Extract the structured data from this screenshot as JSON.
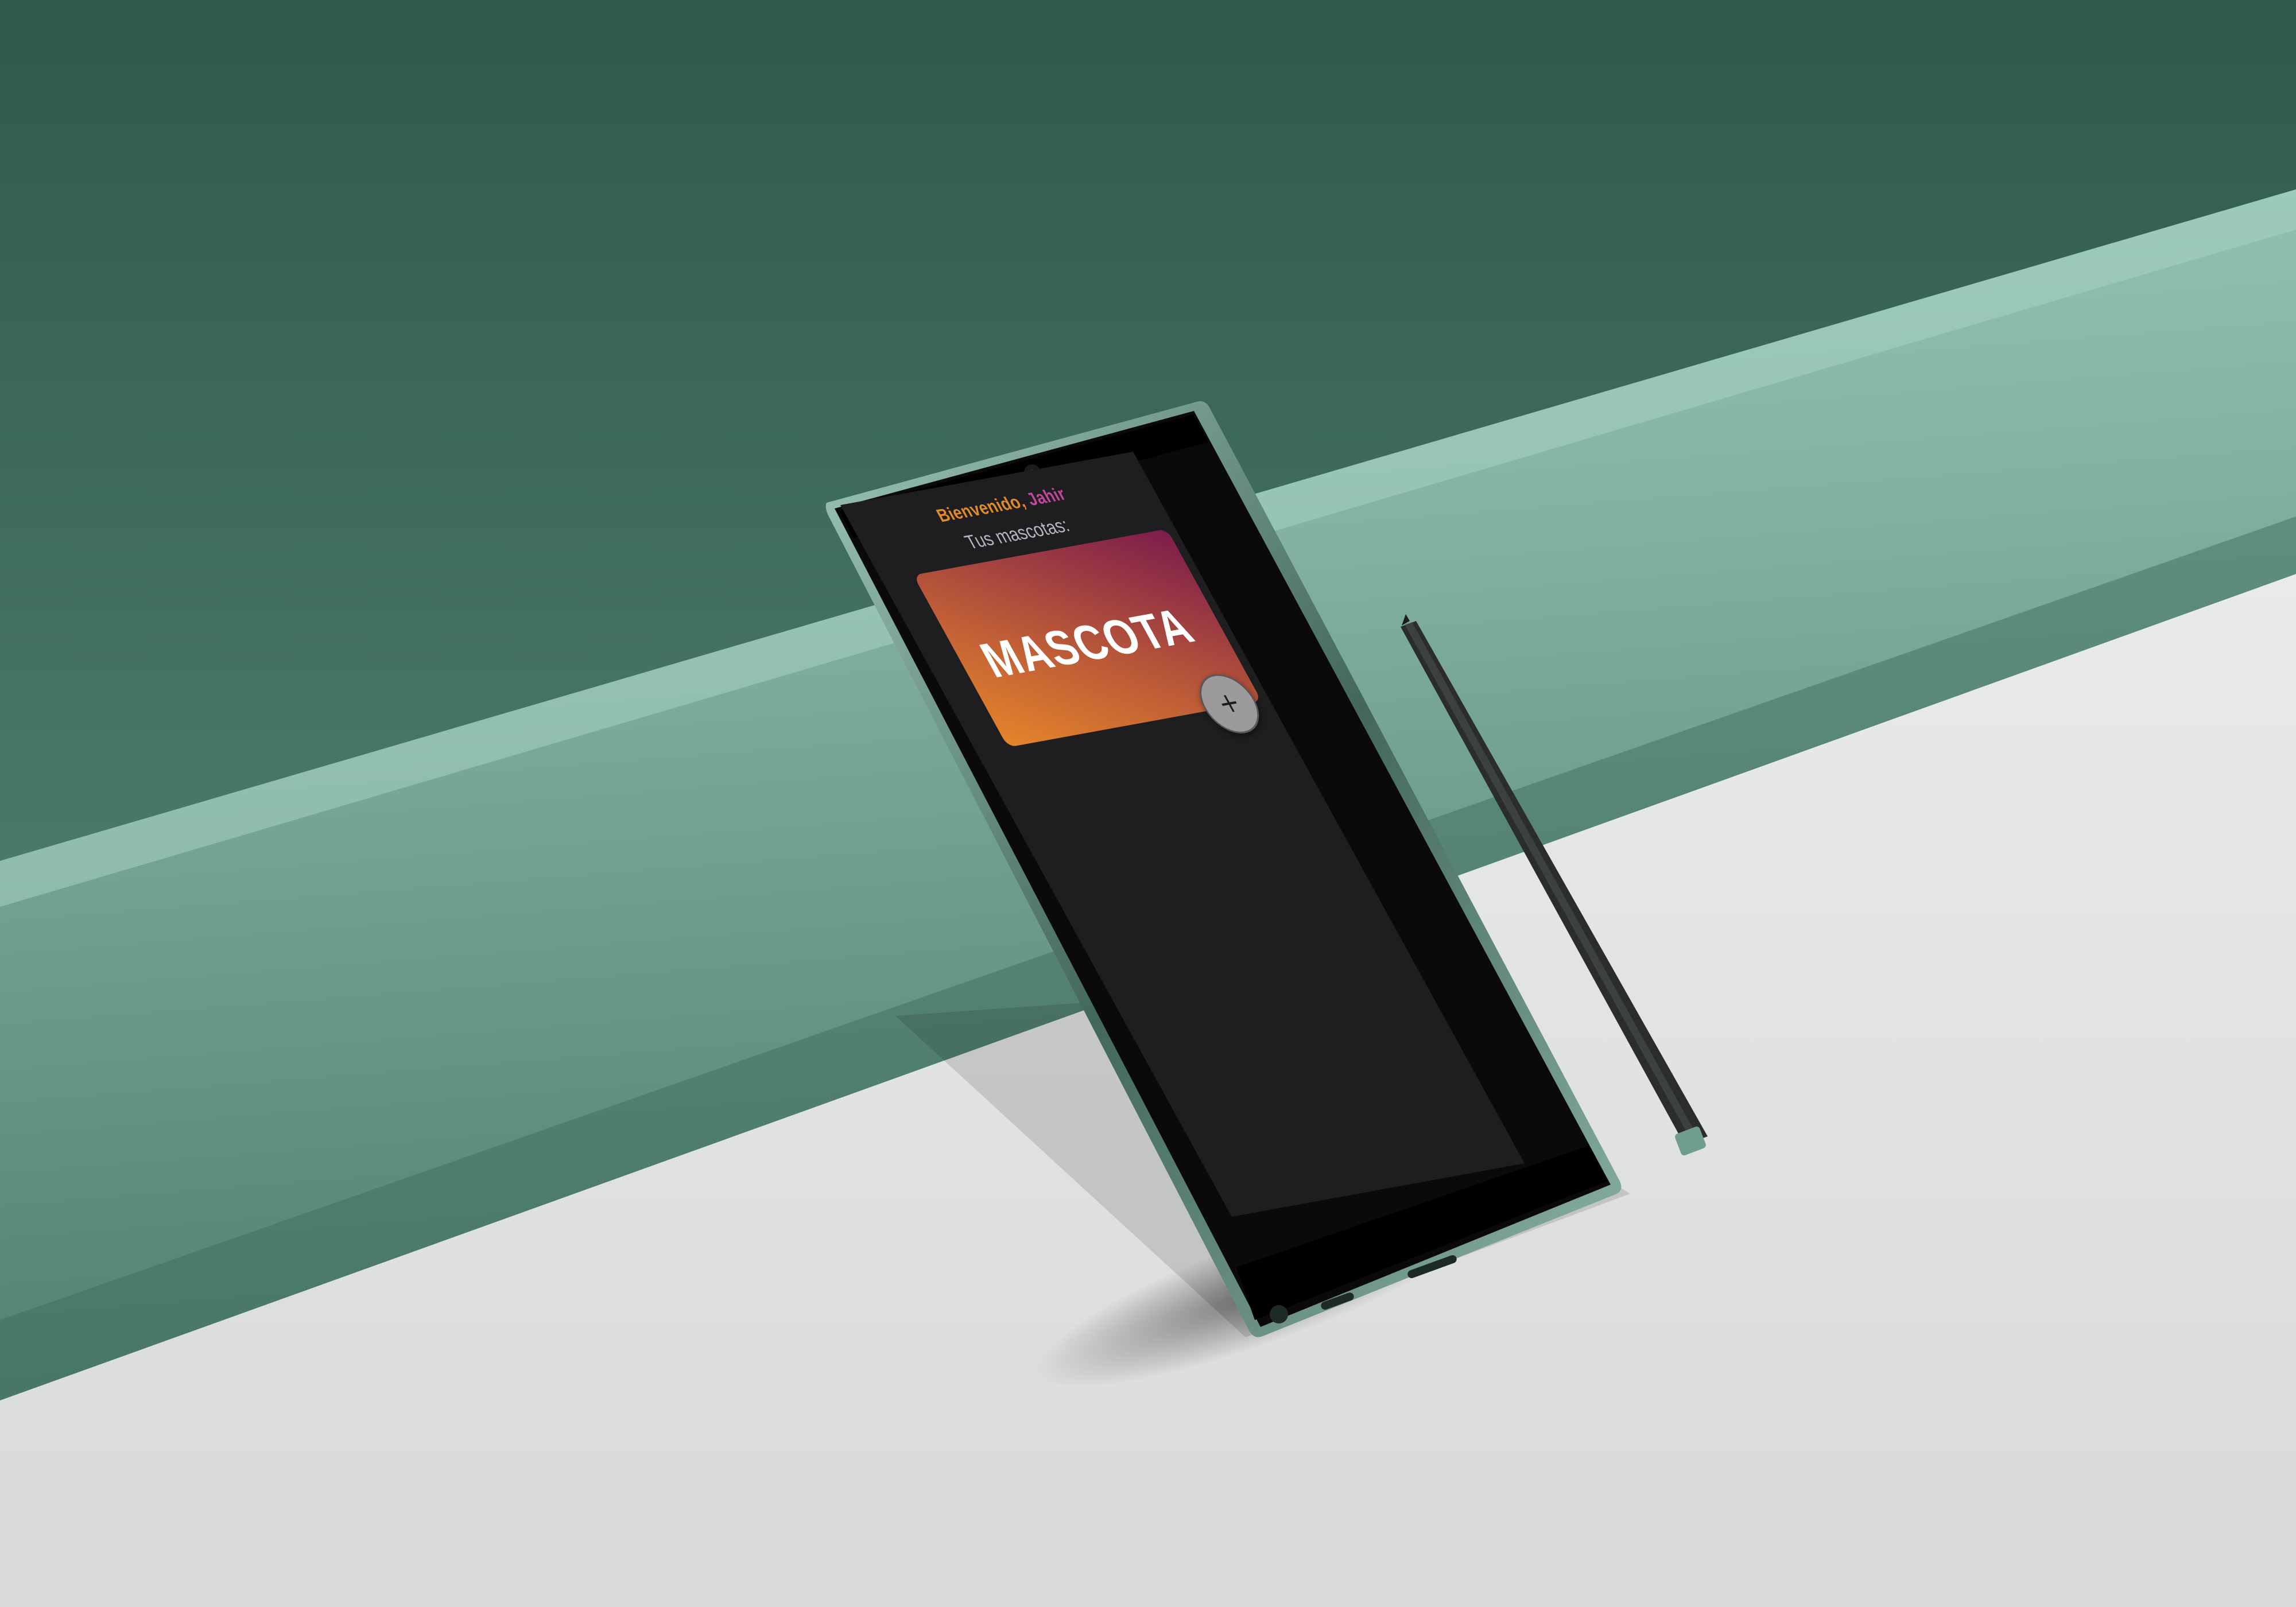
{
  "app": {
    "greeting_prefix": "Bienvenido,",
    "user_name": "Jahir",
    "pets_heading": "Tus mascotas:",
    "pet_card_label": "MASCOTA",
    "add_button_symbol": "+"
  },
  "colors": {
    "screen_background": "#1e1d20",
    "greeting_accent": "#e08a2a",
    "name_accent": "#c0479a",
    "card_gradient_start": "#e5852a",
    "card_gradient_end": "#7c1c4c",
    "add_button": "#9c9a9d",
    "backdrop_green": "#4a7b6a",
    "floor": "#e4e6e6"
  },
  "icons": {
    "add_button_icon": "plus-icon",
    "camera": "front-camera-icon"
  }
}
